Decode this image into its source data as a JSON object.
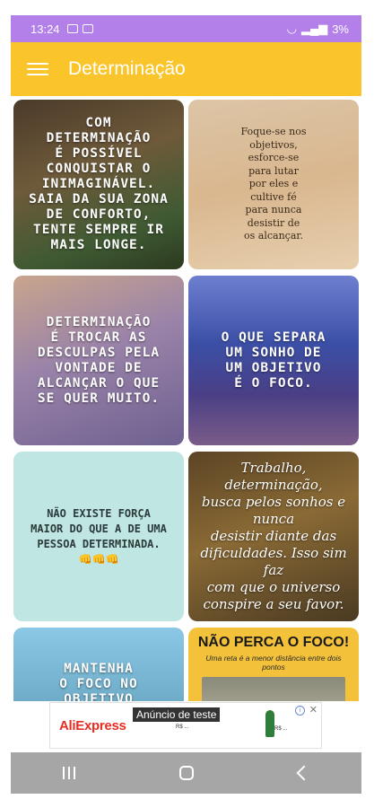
{
  "status_bar": {
    "time": "13:24",
    "battery": "3%"
  },
  "app_bar": {
    "title": "Determinação",
    "menu_icon": "hamburger-menu-icon"
  },
  "cards": [
    {
      "text": "Com\ndeterminação\né possível\nconquistar o\ninimaginável.\nSaia da sua zona\nde conforto,\ntente sempre ir\nmais longe."
    },
    {
      "text": "Foque-se nos\nobjetivos,\nesforce-se\npara lutar\npor eles e\ncultive fé\npara nunca\ndesistir de\nos alcançar."
    },
    {
      "text": "Determinação\né trocar as\ndesculpas pela\nvontade de\nalcançar o que\nse quer muito."
    },
    {
      "text": "O que separa\num sonho de\num objetivo\né o foco."
    },
    {
      "text": "NÃO EXISTE FORÇA\nMAIOR DO QUE A DE UMA\nPESSOA DETERMINADA.\n👊👊👊"
    },
    {
      "text": "Trabalho, determinação,\nbusca pelos sonhos e nunca\ndesistir diante das\ndificuldades. Isso sim faz\ncom que o universo\nconspire a seu favor."
    },
    {
      "text": "Mantenha\no foco no\nobjetivo"
    },
    {
      "heading": "NÃO PERCA O FOCO!",
      "subtext": "Uma reta é a menor distância entre dois pontos"
    }
  ],
  "ad": {
    "brand": "AliExpress",
    "label": "Anúncio de teste",
    "product_text": "R$ ...",
    "figure_text": "R$ ..."
  }
}
